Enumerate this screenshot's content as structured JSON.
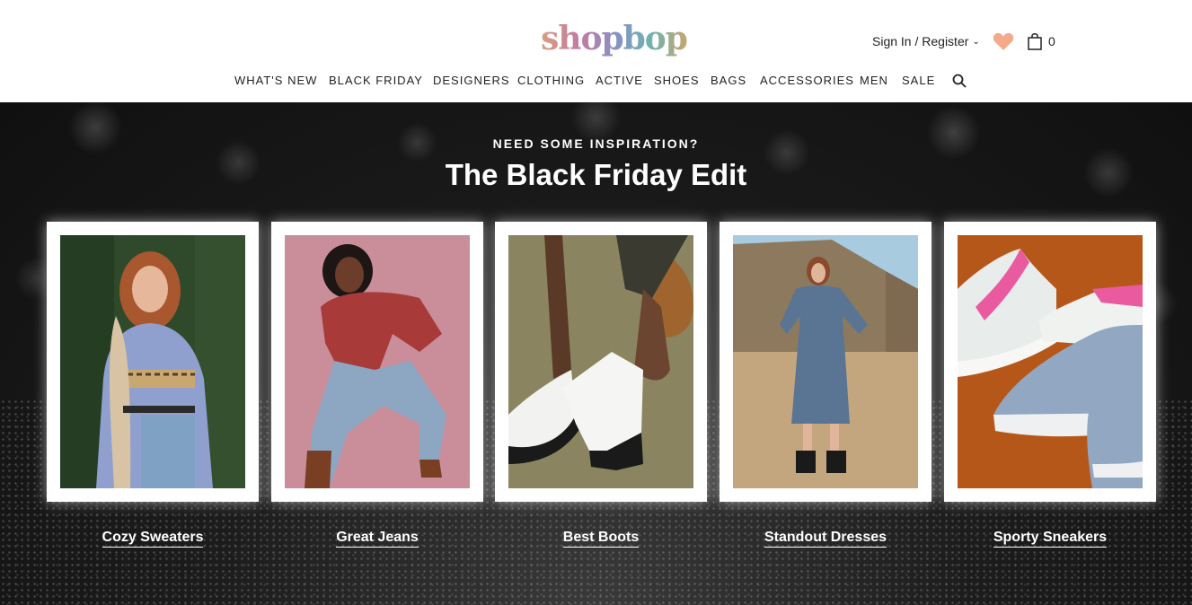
{
  "header": {
    "logo_text": "shopbop",
    "account_label": "Sign In / Register",
    "bag_count": "0",
    "heart_color": "#f4a98a"
  },
  "nav": {
    "items": [
      "WHAT'S NEW",
      "BLACK FRIDAY",
      "DESIGNERS",
      "CLOTHING",
      "ACTIVE",
      "SHOES",
      "BAGS",
      "ACCESSORIES",
      "MEN",
      "SALE"
    ]
  },
  "hero": {
    "kicker": "NEED SOME INSPIRATION?",
    "headline": "The Black Friday Edit",
    "cards": [
      {
        "label": "Cozy Sweaters"
      },
      {
        "label": "Great Jeans"
      },
      {
        "label": "Best Boots"
      },
      {
        "label": "Standout Dresses"
      },
      {
        "label": "Sporty Sneakers"
      }
    ]
  }
}
